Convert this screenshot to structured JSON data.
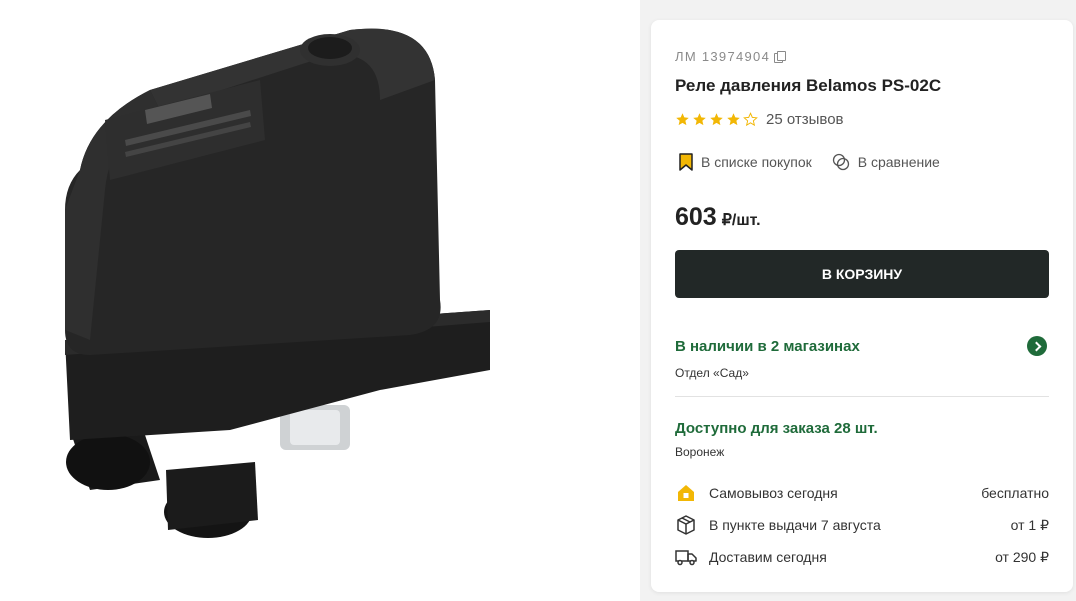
{
  "product": {
    "sku": "ЛМ 13974904",
    "title": "Реле давления Belamos PS-02C",
    "rating": 4,
    "rating_max": 5,
    "reviews": "25 отзывов",
    "shopping_list": "В списке покупок",
    "compare": "В сравнение",
    "price": "603",
    "price_unit": "₽/шт.",
    "cart_label": "В КОРЗИНУ"
  },
  "stock": {
    "title": "В наличии в 2 магазинах",
    "department": "Отдел «Сад»"
  },
  "availability": {
    "title": "Доступно для заказа 28 шт.",
    "city": "Воронеж"
  },
  "delivery": [
    {
      "icon": "house-icon",
      "label": "Самовывоз сегодня",
      "price": "бесплатно"
    },
    {
      "icon": "box-icon",
      "label": "В пункте выдачи 7 августа",
      "price": "от 1 ₽"
    },
    {
      "icon": "truck-icon",
      "label": "Доставим сегодня",
      "price": "от 290 ₽"
    }
  ],
  "colors": {
    "accent_green": "#1f6b3a",
    "star_yellow": "#f2b705",
    "button_dark": "#222827"
  }
}
